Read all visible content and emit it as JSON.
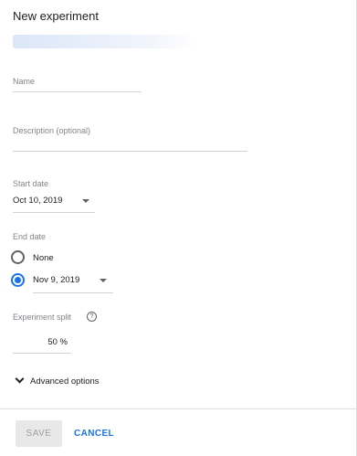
{
  "dialog": {
    "title": "New experiment"
  },
  "form": {
    "name": {
      "label": "Name",
      "value": ""
    },
    "description": {
      "label": "Description (optional)",
      "value": ""
    },
    "start_date": {
      "label": "Start date",
      "value": "Oct 10, 2019"
    },
    "end_date": {
      "label": "End date",
      "options": [
        {
          "label": "None",
          "selected": false
        },
        {
          "label": "Nov 9, 2019",
          "selected": true
        }
      ]
    },
    "experiment_split": {
      "label": "Experiment split",
      "value": "50",
      "unit": "%",
      "help_icon": "help-circle-icon"
    },
    "advanced_options": {
      "label": "Advanced options",
      "expanded": false
    }
  },
  "actions": {
    "save_label": "SAVE",
    "cancel_label": "CANCEL"
  },
  "colors": {
    "accent": "#1a73e8",
    "label_gray": "#80868b",
    "disabled_bg": "#e8e8e8"
  }
}
